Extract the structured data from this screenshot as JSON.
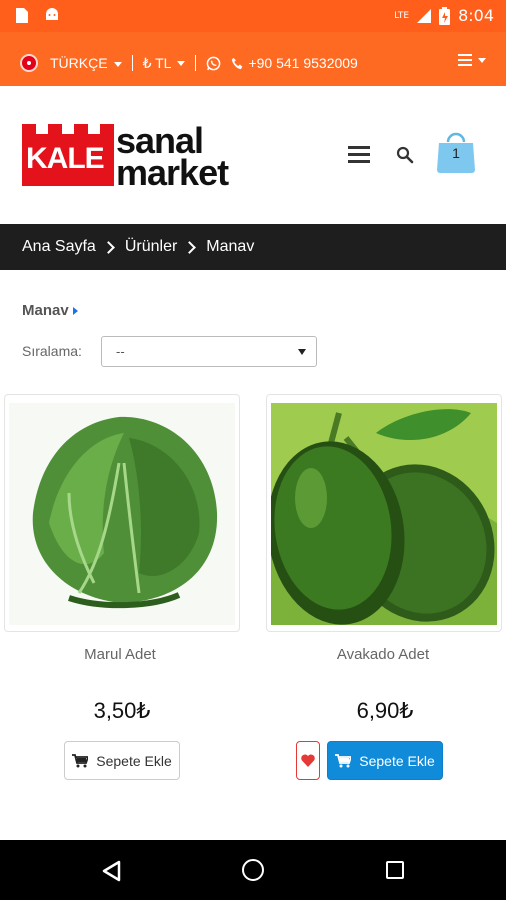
{
  "status_bar": {
    "time": "8:04",
    "network": "LTE"
  },
  "top_bar": {
    "language": "TÜRKÇE",
    "currency": "₺ TL",
    "phone": "+90 541 9532009"
  },
  "header": {
    "logo": {
      "part1": "KALE",
      "part2": "sanal",
      "part3": "market"
    },
    "cart_count": "1"
  },
  "breadcrumb": {
    "items": [
      "Ana Sayfa",
      "Ürünler",
      "Manav"
    ]
  },
  "category": {
    "title": "Manav",
    "sort_label": "Sıralama:",
    "sort_value": "--"
  },
  "products": [
    {
      "name": "Marul Adet",
      "price": "3,50₺",
      "add_label": "Sepete Ekle",
      "style": "light"
    },
    {
      "name": "Avakado Adet",
      "price": "6,90₺",
      "add_label": "Sepete Ekle",
      "style": "blue",
      "favorite": true
    }
  ],
  "colors": {
    "brand_orange": "#ff6a22",
    "brand_red": "#e3121b",
    "button_blue": "#108bd9",
    "breadcrumb_bg": "#1e1e1e"
  }
}
